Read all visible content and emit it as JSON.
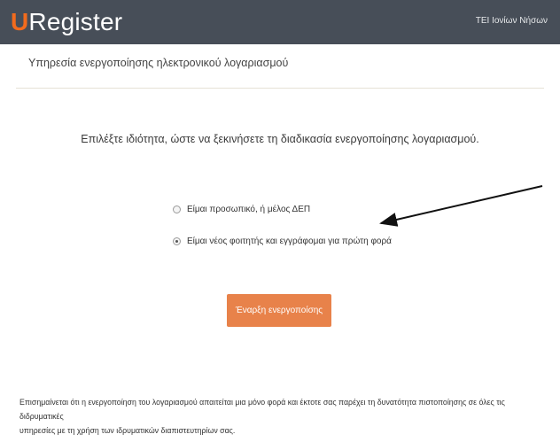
{
  "header": {
    "logo_u": "U",
    "logo_rest": "Register",
    "institution": "ΤΕΙ Ιονίων Νήσων",
    "colors": {
      "bar": "#474e58",
      "logo_accent": "#f26b1d"
    }
  },
  "page": {
    "subtitle": "Υπηρεσία ενεργοποίησης ηλεκτρονικού λογαριασμού",
    "instruction": "Επιλέξτε ιδιότητα, ώστε να ξεκινήσετε τη διαδικασία ενεργοποίησης λογαριασμού."
  },
  "options": [
    {
      "label": "Είμαι προσωπικό, ή μέλος ΔΕΠ",
      "selected": false
    },
    {
      "label": "Είμαι νέος φοιτητής και εγγράφομαι για πρώτη φορά",
      "selected": true
    }
  ],
  "button": {
    "label": "Έναρξη ενεργοποίσης",
    "color": "#e8824a"
  },
  "footer": {
    "note_line1": "Επισημαίνεται ότι η ενεργοποίηση του λογαριασμού απαιτείται μια μόνο φορά και έκτοτε σας παρέχει τη δυνατότητα πιστοποίησης σε όλες τις διδρυματικές",
    "note_line2": "υπηρεσίες με τη χρήση των ιδρυματικών διαπιστευτηρίων σας."
  }
}
